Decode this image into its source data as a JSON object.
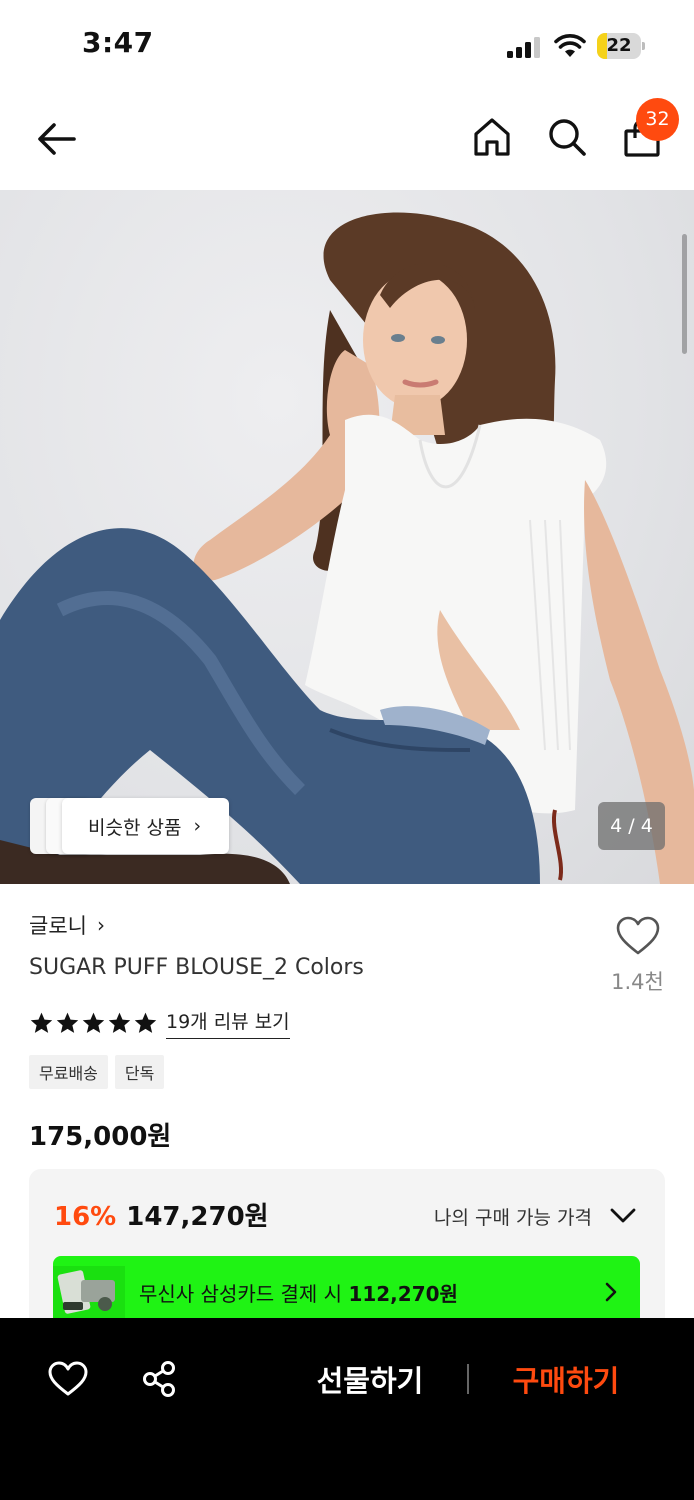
{
  "status_bar": {
    "time": "3:47",
    "battery_level": "22",
    "battery_fill": 0.22
  },
  "header": {
    "icons": [
      "back-arrow-icon",
      "home-icon",
      "search-icon",
      "shopping-bag-icon"
    ],
    "cart_count": "32"
  },
  "gallery": {
    "similar_products_label": "비슷한 상품",
    "page_counter": "4 / 4"
  },
  "product": {
    "brand": "글로니",
    "name": "SUGAR PUFF BLOUSE_2 Colors",
    "like_count": "1.4천",
    "rating_stars": 5,
    "review_link": "19개 리뷰 보기",
    "tags": [
      "무료배송",
      "단독"
    ],
    "original_price": "175,000원"
  },
  "price_box": {
    "discount_rate": "16%",
    "sale_price": "147,270원",
    "my_price_label": "나의 구매 가능 가격",
    "card_promo_text": "무신사 삼성카드 결제 시",
    "card_promo_price": "112,270원"
  },
  "bottom_bar": {
    "gift_label": "선물하기",
    "buy_label": "구매하기"
  },
  "colors": {
    "accent_orange": "#ff4a0f",
    "promo_green": "#1ff314",
    "bottom_bar_bg": "#000000"
  }
}
